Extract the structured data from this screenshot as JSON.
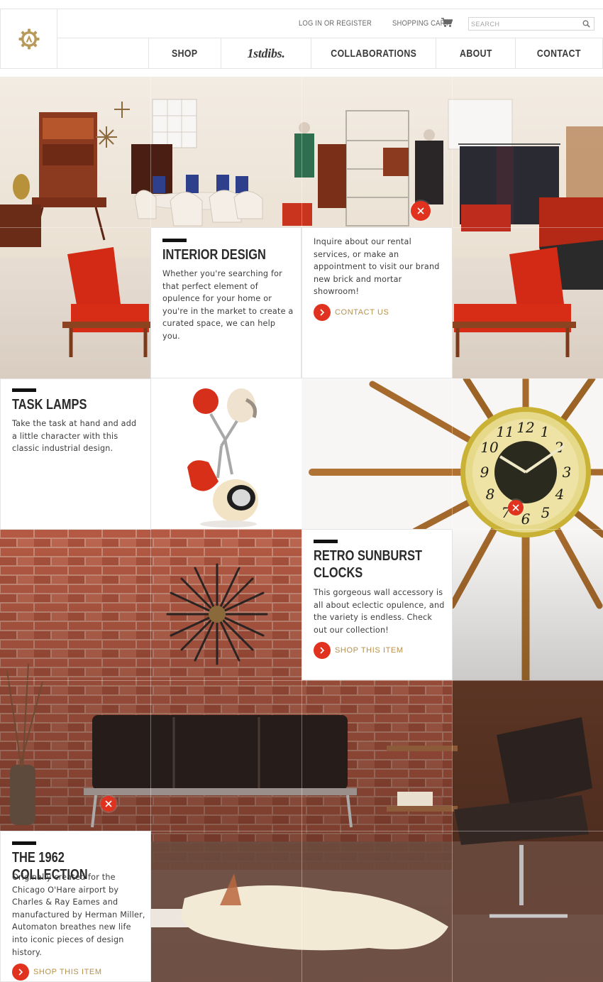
{
  "header": {
    "login_label": "LOG IN OR REGISTER",
    "cart_label": "SHOPPING CART",
    "search_placeholder": "SEARCH"
  },
  "nav": {
    "items": [
      {
        "label": "SHOP"
      },
      {
        "label": "1stdibs."
      },
      {
        "label": "COLLABORATIONS"
      },
      {
        "label": "ABOUT"
      },
      {
        "label": "CONTACT"
      }
    ]
  },
  "interior": {
    "title": "INTERIOR DESIGN",
    "text": "Whether you're searching for that perfect element of opulence for your home or you're in the market to create a curated space, we can help you.",
    "inquire_text": "Inquire about our rental services, or make an appointment to visit our brand new brick and mortar showroom!",
    "cta_label": "CONTACT US"
  },
  "lamps": {
    "title": "TASK LAMPS",
    "text": "Take the task at hand and add a little character with this classic industrial design."
  },
  "clocks": {
    "title": "RETRO SUNBURST\nCLOCKS",
    "text": "This gorgeous wall accessory is all about eclectic opulence, and the variety is endless. Check out our collection!",
    "cta_label": "SHOP THIS ITEM"
  },
  "collection": {
    "title": "THE 1962 COLLECTION",
    "text": "Originally created for the Chicago O'Hare airport by Charles & Ray Eames and manufactured by Herman Miller, Automaton breathes new life into iconic pieces of design history.",
    "cta_label": "SHOP THIS ITEM"
  },
  "colors": {
    "accent_red": "#e0321f",
    "cta_gold": "#b7914a",
    "logo_gold": "#b89a5a"
  },
  "icons": [
    "logo-gear-icon",
    "cart-icon",
    "search-icon",
    "chevron-right-icon",
    "close-x-icon"
  ]
}
